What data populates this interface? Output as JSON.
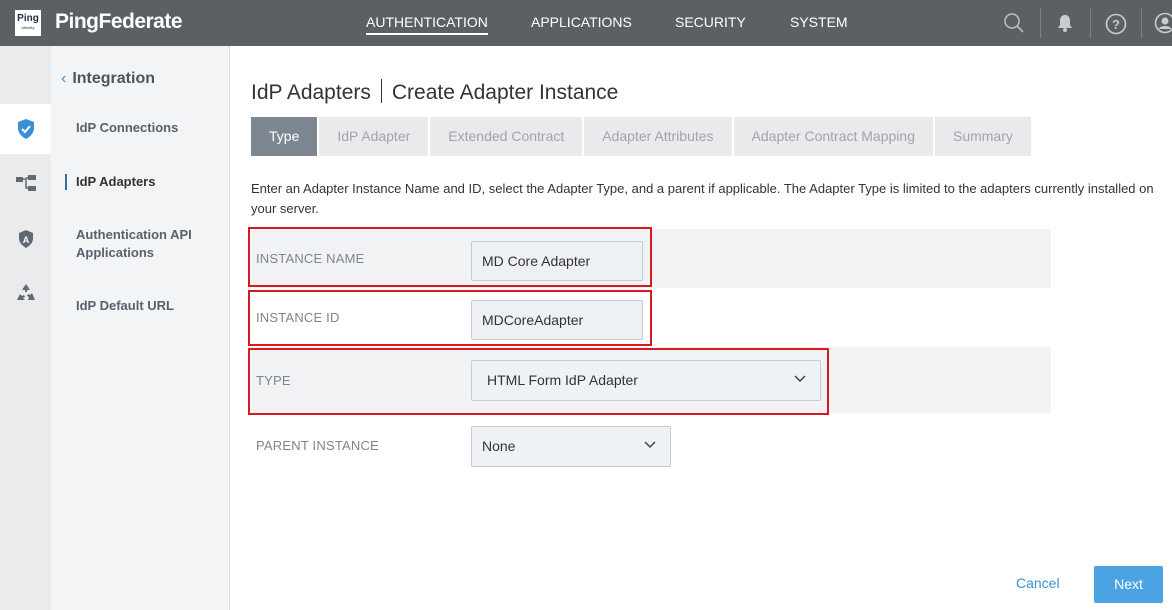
{
  "app": {
    "logo_mark": "Ping",
    "logo_sub": "Identity",
    "name": "PingFederate"
  },
  "topnav": {
    "items": [
      {
        "label": "AUTHENTICATION",
        "active": true
      },
      {
        "label": "APPLICATIONS"
      },
      {
        "label": "SECURITY"
      },
      {
        "label": "SYSTEM"
      }
    ],
    "icons": [
      "search-icon",
      "bell-icon",
      "help-icon",
      "user-icon"
    ]
  },
  "sidebar": {
    "section": "Integration",
    "items": [
      {
        "label": "IdP Connections"
      },
      {
        "label": "IdP Adapters",
        "active": true
      },
      {
        "label": "Authentication API Applications"
      },
      {
        "label": "IdP Default URL"
      }
    ],
    "rail_icons": [
      "shield-check-icon",
      "hierarchy-icon",
      "shield-a-icon",
      "recycle-icon"
    ]
  },
  "page": {
    "breadcrumb": "IdP Adapters",
    "title": "Create Adapter Instance",
    "tabs": [
      {
        "label": "Type",
        "active": true
      },
      {
        "label": "IdP Adapter"
      },
      {
        "label": "Extended Contract"
      },
      {
        "label": "Adapter Attributes"
      },
      {
        "label": "Adapter Contract Mapping"
      },
      {
        "label": "Summary"
      }
    ],
    "description": "Enter an Adapter Instance Name and ID, select the Adapter Type, and a parent if applicable. The Adapter Type is limited to the adapters currently installed on your server."
  },
  "form": {
    "instance_name": {
      "label": "INSTANCE NAME",
      "value": "MD Core Adapter"
    },
    "instance_id": {
      "label": "INSTANCE ID",
      "value": "MDCoreAdapter"
    },
    "type": {
      "label": "TYPE",
      "value": "HTML Form IdP Adapter"
    },
    "parent_instance": {
      "label": "PARENT INSTANCE",
      "value": "None"
    }
  },
  "actions": {
    "cancel": "Cancel",
    "next": "Next"
  },
  "colors": {
    "topbar": "#5b6065",
    "accent": "#3a8fd6",
    "next_button": "#4ba3e3",
    "highlight": "#d71920"
  }
}
